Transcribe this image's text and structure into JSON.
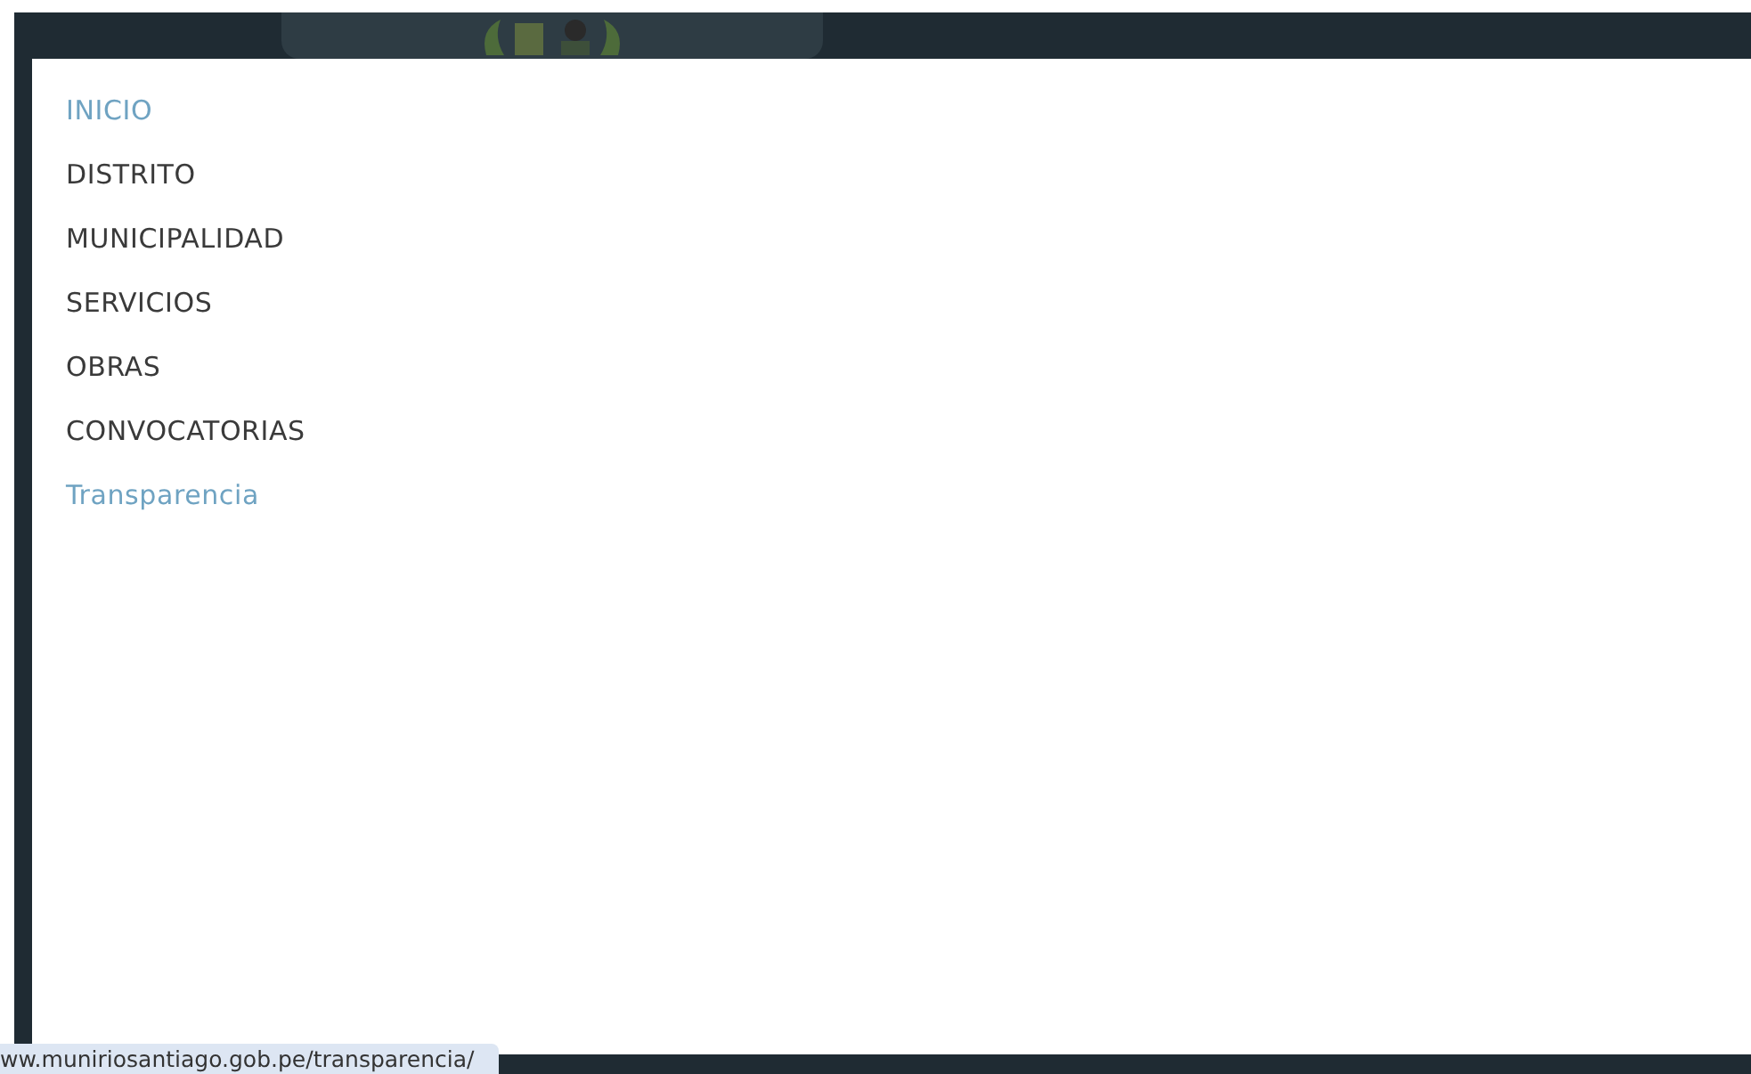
{
  "menu": {
    "items": [
      {
        "label": "INICIO",
        "highlighted": true
      },
      {
        "label": "DISTRITO",
        "highlighted": false
      },
      {
        "label": "MUNICIPALIDAD",
        "highlighted": false
      },
      {
        "label": "SERVICIOS",
        "highlighted": false
      },
      {
        "label": "OBRAS",
        "highlighted": false
      },
      {
        "label": "CONVOCATORIAS",
        "highlighted": false
      },
      {
        "label": "Transparencia",
        "highlighted": true
      }
    ]
  },
  "status_bar": {
    "url": "ww.muniriosantiago.gob.pe/transparencia/"
  }
}
